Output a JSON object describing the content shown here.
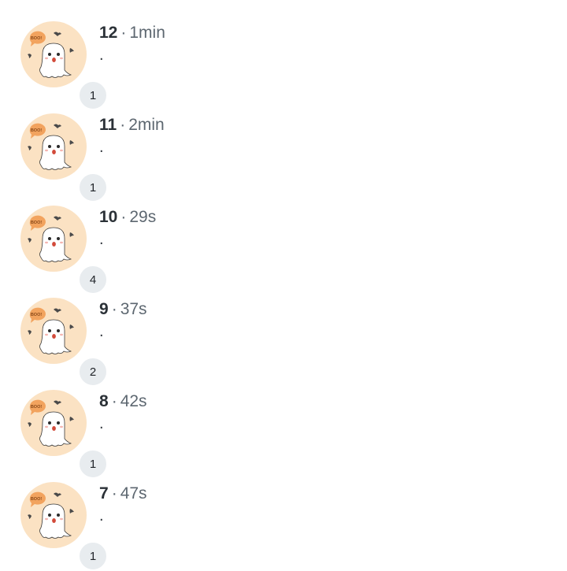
{
  "rows": [
    {
      "number": "12",
      "separator": "·",
      "time": "1min",
      "text": ".",
      "badge": "1",
      "avatar_icon": "ghost-boo-icon"
    },
    {
      "number": "11",
      "separator": "·",
      "time": "2min",
      "text": ".",
      "badge": "1",
      "avatar_icon": "ghost-boo-icon"
    },
    {
      "number": "10",
      "separator": "·",
      "time": "29s",
      "text": ".",
      "badge": "4",
      "avatar_icon": "ghost-boo-icon"
    },
    {
      "number": "9",
      "separator": "·",
      "time": "37s",
      "text": ".",
      "badge": "2",
      "avatar_icon": "ghost-boo-icon"
    },
    {
      "number": "8",
      "separator": "·",
      "time": "42s",
      "text": ".",
      "badge": "1",
      "avatar_icon": "ghost-boo-icon"
    },
    {
      "number": "7",
      "separator": "·",
      "time": "47s",
      "text": ".",
      "badge": "1",
      "avatar_icon": "ghost-boo-icon"
    }
  ],
  "avatar": {
    "boo_text": "BOO!"
  },
  "colors": {
    "avatar_background": "#fbe2c3",
    "badge_background": "#e8ecef",
    "ghost": "#ffffff",
    "speech_bubble": "#f2a35e",
    "bats": "#4a4a4a"
  }
}
